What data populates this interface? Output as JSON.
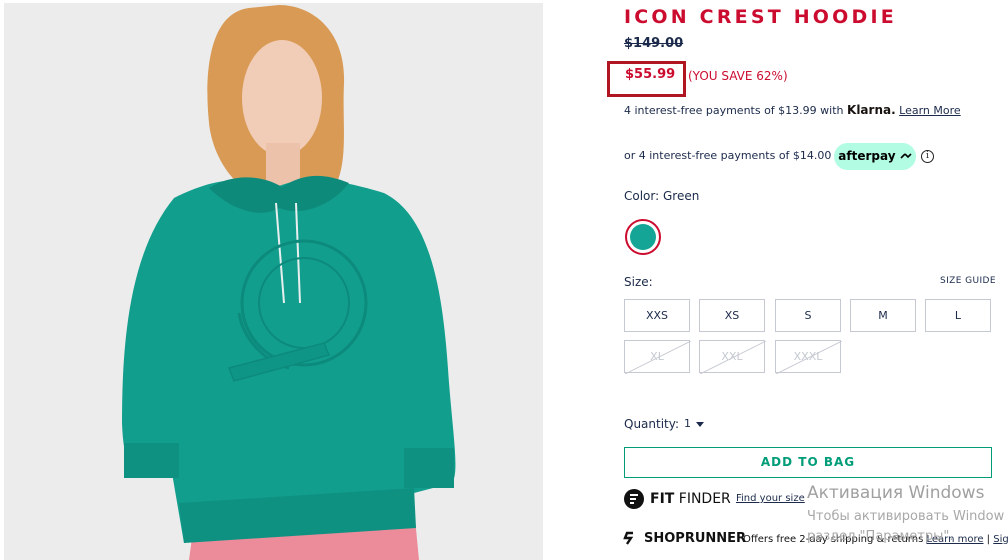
{
  "product": {
    "title": "ICON CREST HOODIE",
    "original_price": "$149.00",
    "sale_price": "$55.99",
    "you_save": "(YOU SAVE 62%)"
  },
  "klarna": {
    "text": "4 interest-free payments of $13.99 with",
    "brand": "Klarna.",
    "link": "Learn More"
  },
  "afterpay": {
    "text": "or 4 interest-free payments of $14.00 with",
    "badge": "afterpay",
    "info_icon": "info-icon"
  },
  "color": {
    "label": "Color: Green",
    "swatch_color": "#14a596",
    "selected_ring_color": "#cc0c2f"
  },
  "size": {
    "label": "Size:",
    "guide": "SIZE GUIDE",
    "options": [
      {
        "label": "XXS",
        "available": true
      },
      {
        "label": "XS",
        "available": true
      },
      {
        "label": "S",
        "available": true
      },
      {
        "label": "M",
        "available": true
      },
      {
        "label": "L",
        "available": true
      },
      {
        "label": "XL",
        "available": false
      },
      {
        "label": "XXL",
        "available": false
      },
      {
        "label": "XXXL",
        "available": false
      }
    ]
  },
  "quantity": {
    "label": "Quantity:",
    "value": "1"
  },
  "cart": {
    "add_label": "ADD TO BAG",
    "accent": "#009d78"
  },
  "fit_finder": {
    "brand_bold": "FIT",
    "brand_rest": " FINDER",
    "link": "Find your size"
  },
  "shoprunner": {
    "brand": "SHOPRUNNER",
    "offer": "Offers free 2-day shipping & returns",
    "learn_more": "Learn more",
    "sign_in": "Sign i"
  },
  "windows_watermark": {
    "title": "Активация Windows",
    "line1": "Чтобы активировать Window",
    "line2": "раздел \"Параметры\"."
  },
  "colors": {
    "brand_red": "#cc0c2f",
    "navy": "#1b2a4a",
    "afterpay_mint": "#b2fce4"
  }
}
